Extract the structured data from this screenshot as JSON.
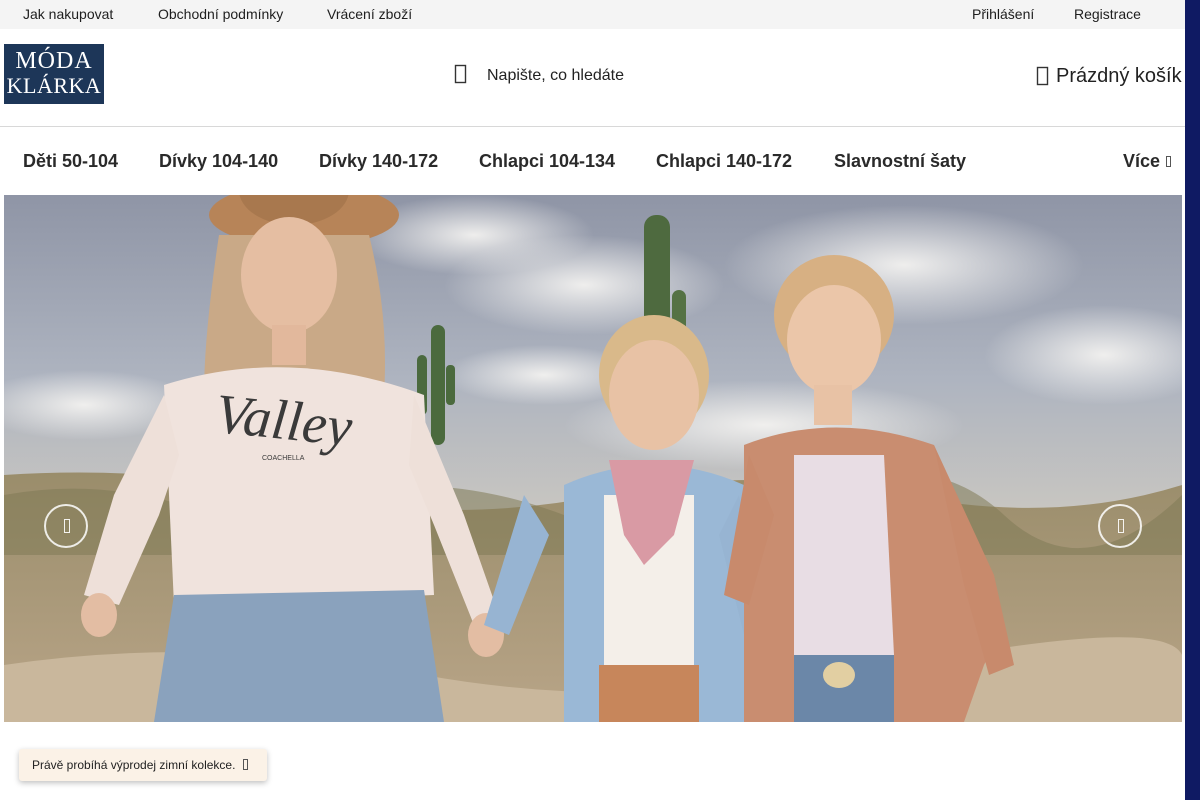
{
  "topbar": {
    "links": [
      "Jak nakupovat",
      "Obchodní podmínky",
      "Vrácení zboží"
    ],
    "login": "Přihlášení",
    "register": "Registrace"
  },
  "header": {
    "logo_line1": "MÓDA",
    "logo_line2": "KLÁRKA",
    "search_placeholder": "Napište, co hledáte",
    "search_icon": "search-icon",
    "cart_label": "Prázdný košík",
    "cart_icon": "cart-icon"
  },
  "nav": {
    "items": [
      "Děti 50-104",
      "Dívky 104-140",
      "Dívky 140-172",
      "Chlapci 104-134",
      "Chlapci 140-172",
      "Slavnostní šaty"
    ],
    "more_label": "Více",
    "more_icon": "chevron-down-icon"
  },
  "hero": {
    "prev_icon": "chevron-left-icon",
    "next_icon": "chevron-right-icon",
    "sweatshirt_print": "Valley",
    "sweatshirt_small": "COACHELLA"
  },
  "toast": {
    "message": "Právě probíhá výprodej zimní kolekce.",
    "close_icon": "close-icon"
  },
  "colors": {
    "brand_navy": "#1d3658",
    "scrollbar": "#0f1a63",
    "toast_bg": "#fbf2e7",
    "topbar_bg": "#f4f4f4"
  }
}
